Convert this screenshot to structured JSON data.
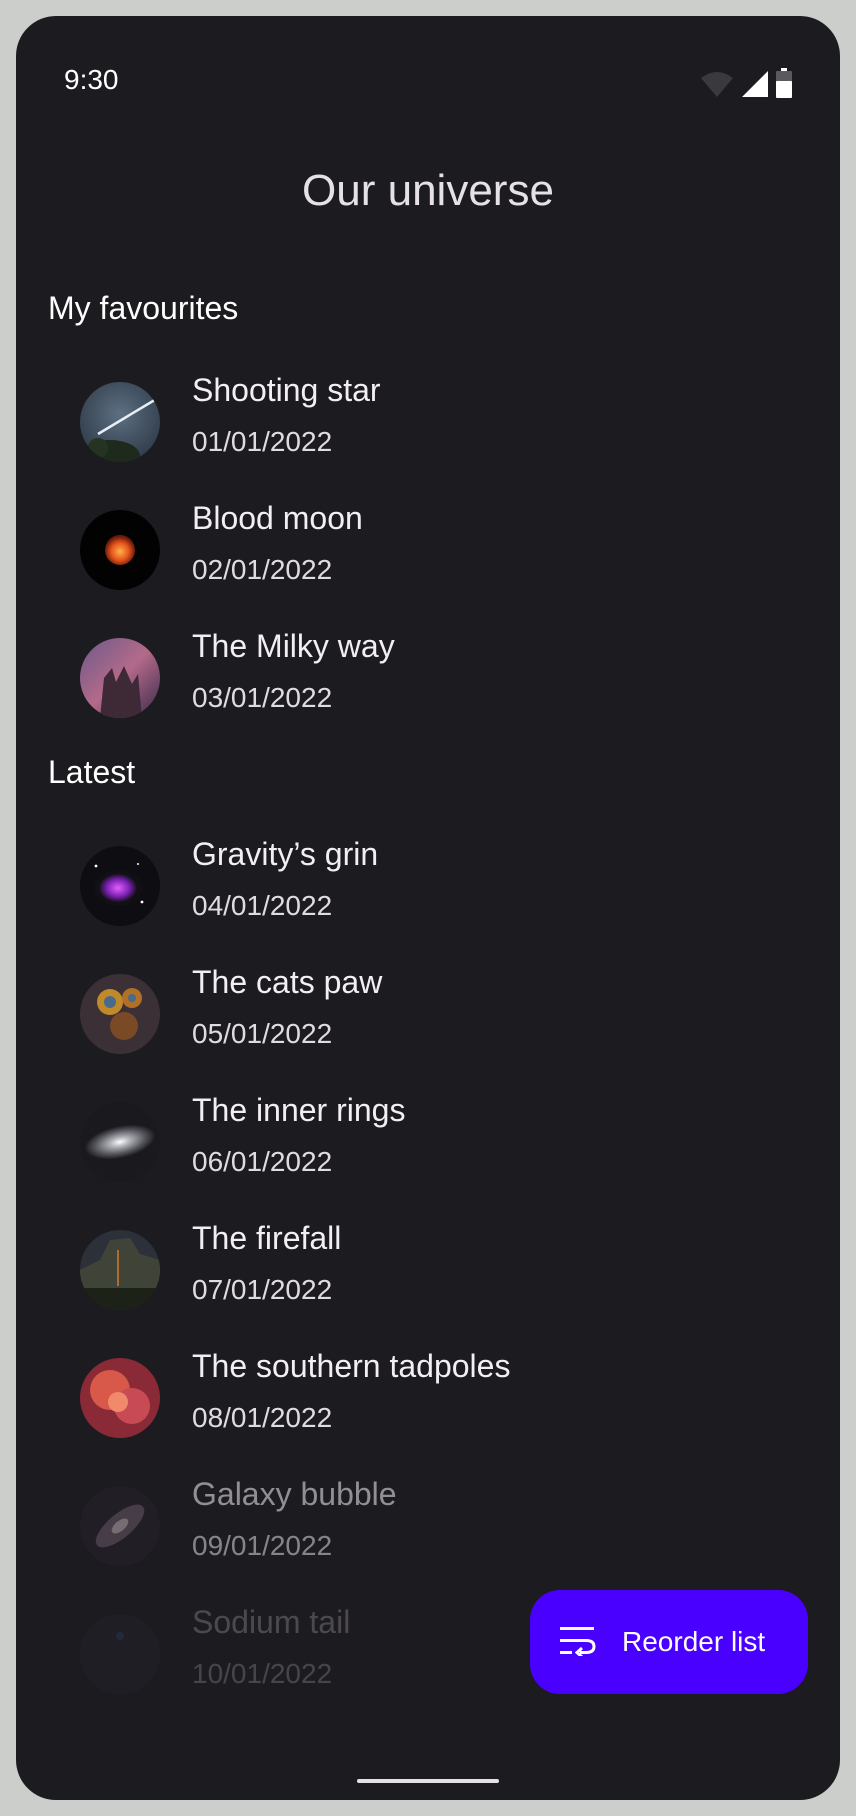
{
  "status_bar": {
    "time": "9:30",
    "icons": [
      "wifi-icon",
      "cell-signal-icon",
      "battery-icon"
    ]
  },
  "app_bar": {
    "title": "Our universe"
  },
  "sections": [
    {
      "header": "My favourites",
      "items": [
        {
          "title": "Shooting star",
          "date": "01/01/2022",
          "thumb": "shooting-star-thumbnail"
        },
        {
          "title": "Blood moon",
          "date": "02/01/2022",
          "thumb": "blood-moon-thumbnail"
        },
        {
          "title": "The Milky way",
          "date": "03/01/2022",
          "thumb": "milky-way-thumbnail"
        }
      ]
    },
    {
      "header": "Latest",
      "items": [
        {
          "title": "Gravity’s grin",
          "date": "04/01/2022",
          "thumb": "gravitys-grin-thumbnail"
        },
        {
          "title": "The cats paw",
          "date": "05/01/2022",
          "thumb": "cats-paw-thumbnail"
        },
        {
          "title": "The inner rings",
          "date": "06/01/2022",
          "thumb": "inner-rings-thumbnail"
        },
        {
          "title": "The firefall",
          "date": "07/01/2022",
          "thumb": "firefall-thumbnail"
        },
        {
          "title": "The southern tadpoles",
          "date": "08/01/2022",
          "thumb": "southern-tadpoles-thumbnail"
        },
        {
          "title": "Galaxy bubble",
          "date": "09/01/2022",
          "thumb": "galaxy-bubble-thumbnail"
        },
        {
          "title": "Sodium tail",
          "date": "10/01/2022",
          "thumb": "sodium-tail-thumbnail"
        }
      ]
    }
  ],
  "fab": {
    "label": "Reorder list",
    "icon": "reorder-list-icon"
  },
  "colors": {
    "background": "#1c1b20",
    "frame": "#cbceca",
    "fab": "#4a00ff",
    "text": "#e6e1e6"
  }
}
